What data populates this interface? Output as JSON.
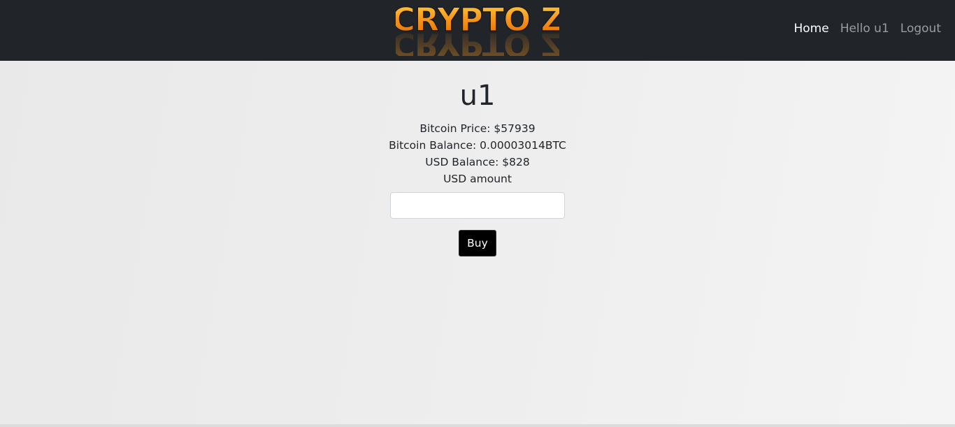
{
  "header": {
    "logo_text": "CRYPTO Z",
    "nav": [
      {
        "label": "Home",
        "active": true
      },
      {
        "label": "Hello u1",
        "active": false
      },
      {
        "label": "Logout",
        "active": false
      }
    ]
  },
  "main": {
    "username": "u1",
    "bitcoin_price": "Bitcoin Price: $57939",
    "bitcoin_balance": "Bitcoin Balance: 0.00003014BTC",
    "usd_balance": "USD Balance: $828",
    "usd_amount_label": "USD amount",
    "usd_amount_value": "",
    "buy_label": "Buy"
  },
  "colors": {
    "navbar": "#212529",
    "logo_fill": "#f7941d",
    "button": "#000000"
  }
}
